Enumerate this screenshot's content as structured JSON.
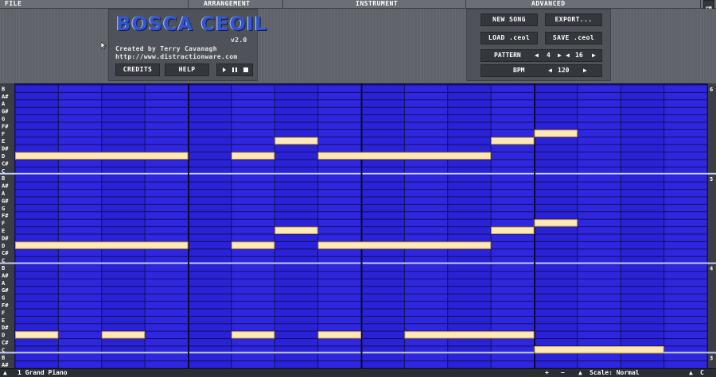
{
  "tabs": {
    "file": "FILE",
    "arrangement": "ARRANGEMENT",
    "instrument": "INSTRUMENT",
    "advanced": "ADVANCED"
  },
  "logo": {
    "title": "BOSCA CEOIL",
    "version": "v2.0",
    "credit_line": "Created by Terry Cavanagh",
    "url": "http://www.distractionware.com",
    "credits_button": "CREDITS",
    "help_button": "HELP"
  },
  "file_panel": {
    "new_song": "NEW SONG",
    "export": "EXPORT...",
    "load": "LOAD .ceol",
    "save": "SAVE .ceol",
    "pattern_label": "PATTERN",
    "pattern_value": "4",
    "pattern_length": "16",
    "bpm_label": "BPM",
    "bpm_value": "120"
  },
  "roll": {
    "row_labels": [
      "B",
      "A#",
      "A",
      "G#",
      "G",
      "F#",
      "F",
      "E",
      "D#",
      "D",
      "C#",
      "C"
    ],
    "octaves": [
      "6",
      "5",
      "4",
      "3"
    ],
    "bottom_extra_labels": [
      "B",
      "A#"
    ],
    "colors": {
      "cell": "#2a22d6",
      "cell_alt": "#2f27e0",
      "grid": "#13105a",
      "beat_line": "#0a0833",
      "note": "#ffe9b8",
      "note_border": "#c89b50",
      "label_bg": "#3a3d43",
      "octave_sep": "#c8d0ff"
    },
    "notes": [
      {
        "octave": 0,
        "note": "D",
        "start": 0,
        "len": 4
      },
      {
        "octave": 0,
        "note": "D",
        "start": 5,
        "len": 1
      },
      {
        "octave": 0,
        "note": "E",
        "start": 6,
        "len": 1
      },
      {
        "octave": 0,
        "note": "D",
        "start": 7,
        "len": 4
      },
      {
        "octave": 0,
        "note": "E",
        "start": 11,
        "len": 1
      },
      {
        "octave": 0,
        "note": "F",
        "start": 12,
        "len": 1
      },
      {
        "octave": 1,
        "note": "D",
        "start": 0,
        "len": 4
      },
      {
        "octave": 1,
        "note": "D",
        "start": 5,
        "len": 1
      },
      {
        "octave": 1,
        "note": "E",
        "start": 6,
        "len": 1
      },
      {
        "octave": 1,
        "note": "D",
        "start": 7,
        "len": 4
      },
      {
        "octave": 1,
        "note": "E",
        "start": 11,
        "len": 1
      },
      {
        "octave": 1,
        "note": "F",
        "start": 12,
        "len": 1
      },
      {
        "octave": 2,
        "note": "D",
        "start": 0,
        "len": 1
      },
      {
        "octave": 2,
        "note": "D",
        "start": 2,
        "len": 1
      },
      {
        "octave": 2,
        "note": "D",
        "start": 5,
        "len": 1
      },
      {
        "octave": 2,
        "note": "D",
        "start": 7,
        "len": 1
      },
      {
        "octave": 2,
        "note": "D",
        "start": 9,
        "len": 3
      },
      {
        "octave": 2,
        "note": "C",
        "start": 12,
        "len": 3
      }
    ]
  },
  "status": {
    "instrument": "1 Grand Piano",
    "plus": "+",
    "minus": "−",
    "scale": "Scale: Normal",
    "key": "C"
  }
}
